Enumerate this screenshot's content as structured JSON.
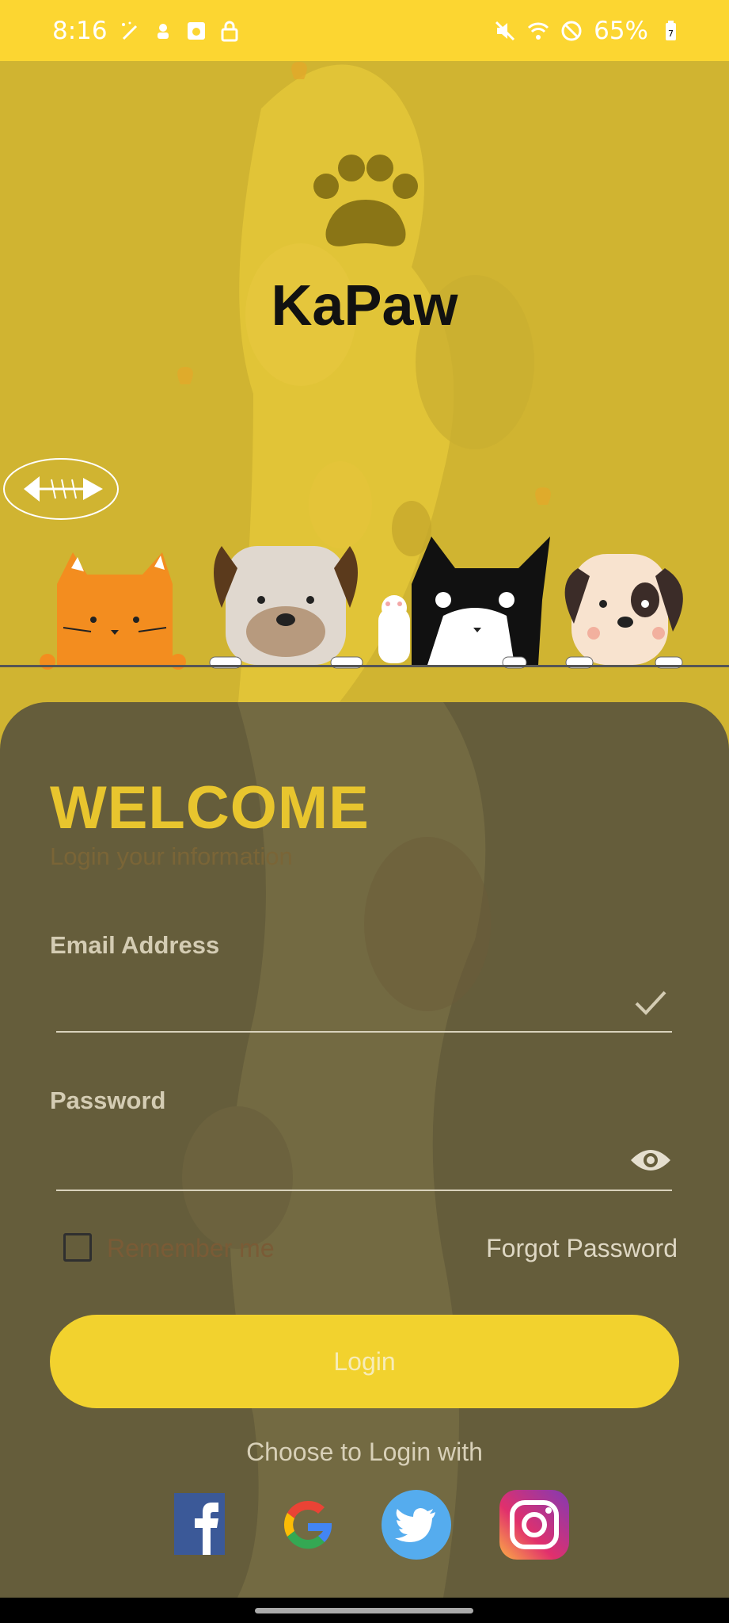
{
  "status_bar": {
    "time": "8:16",
    "battery": "65%",
    "icons_left": [
      "magic-wand-icon",
      "flower-icon",
      "camera-box-icon",
      "lock-icon"
    ],
    "icons_right": [
      "mute-icon",
      "wifi-icon",
      "do-not-disturb-icon",
      "battery-icon"
    ]
  },
  "app": {
    "name": "KaPaw"
  },
  "login": {
    "welcome": "WELCOME",
    "subtitle": "Login your information",
    "email_label": "Email Address",
    "email_value": "",
    "password_label": "Password",
    "password_value": "",
    "remember_label": "Remember me",
    "forgot_label": "Forgot Password",
    "login_button": "Login",
    "choose_label": "Choose to Login with",
    "social": [
      "facebook-icon",
      "google-icon",
      "twitter-icon",
      "instagram-icon"
    ]
  },
  "colors": {
    "accent": "#fcd631",
    "panel": "#655d3b",
    "button": "#f2d22e"
  }
}
